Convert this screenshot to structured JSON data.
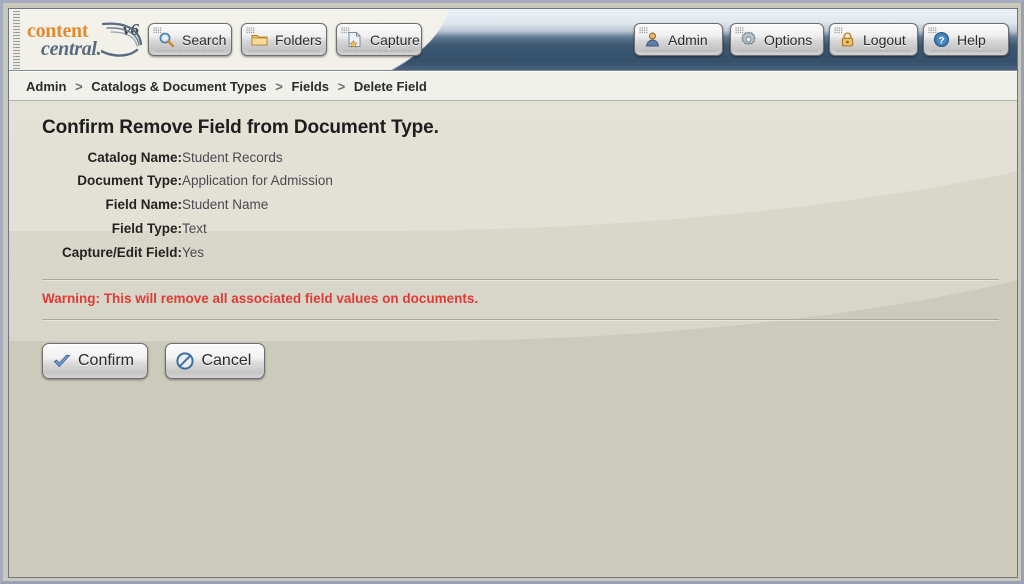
{
  "brand": {
    "name_top": "content",
    "name_bottom": "central.",
    "version": "v6",
    "swoosh_icon": "swoosh-icon"
  },
  "toolbar": {
    "left_buttons": [
      {
        "label": "Search",
        "icon": "search-icon",
        "name": "search"
      },
      {
        "label": "Folders",
        "icon": "folder-icon",
        "name": "folders"
      },
      {
        "label": "Capture",
        "icon": "capture-icon",
        "name": "capture"
      }
    ],
    "right_buttons": [
      {
        "label": "Admin",
        "icon": "user-icon",
        "name": "admin"
      },
      {
        "label": "Options",
        "icon": "gear-icon",
        "name": "options"
      },
      {
        "label": "Logout",
        "icon": "padlock-icon",
        "name": "logout"
      },
      {
        "label": "Help",
        "icon": "question-icon",
        "name": "help"
      }
    ]
  },
  "breadcrumb": {
    "separator": ">",
    "items": [
      "Admin",
      "Catalogs & Document Types",
      "Fields",
      "Delete Field"
    ]
  },
  "page": {
    "title": "Confirm Remove Field from Document Type.",
    "details": [
      {
        "label": "Catalog Name:",
        "value": "Student Records"
      },
      {
        "label": "Document Type:",
        "value": "Application for Admission"
      },
      {
        "label": "Field Name:",
        "value": "Student Name"
      },
      {
        "label": "Field Type:",
        "value": "Text"
      },
      {
        "label": "Capture/Edit Field:",
        "value": "Yes"
      }
    ],
    "warning": "Warning: This will remove all associated field values on documents.",
    "actions": [
      {
        "label": "Confirm",
        "icon": "check-icon",
        "name": "confirm"
      },
      {
        "label": "Cancel",
        "icon": "cancel-icon",
        "name": "cancel"
      }
    ]
  },
  "colors": {
    "header_dark": "#3c5872",
    "body_bg": "#cbcabb",
    "panel_bg": "#e2e0d4",
    "warning_red": "#e03b36",
    "brand_orange": "#e08a33",
    "brand_blue": "#5a6b80"
  }
}
